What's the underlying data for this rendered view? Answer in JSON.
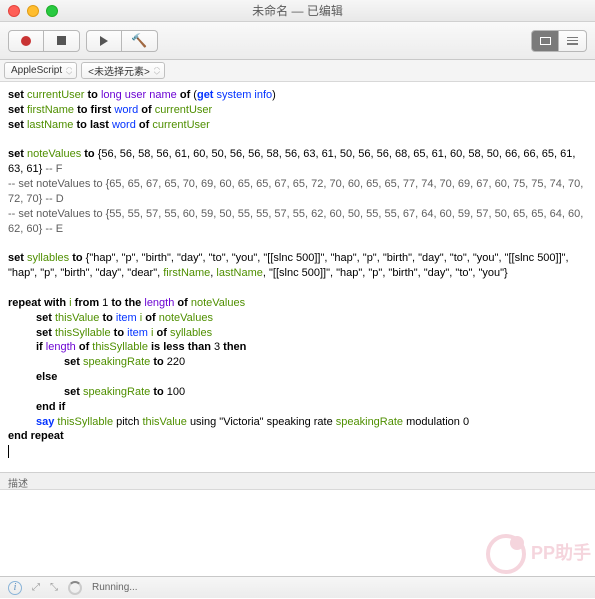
{
  "title": "未命名 — 已编辑",
  "lang_dropdown": "AppleScript",
  "elements_dropdown": "<未选择元素>",
  "desc_label": "描述",
  "status_text": "Running...",
  "code": {
    "l1_set": "set",
    "l1_var": "currentUser",
    "l1_to": "to",
    "l1_prop": "long user name",
    "l1_of": "of",
    "l1_paren_open": "(",
    "l1_cmd": "get",
    "l1_sys": "system info",
    "l1_paren_close": ")",
    "l2_var": "firstName",
    "l2_word": "word",
    "l2_src": "currentUser",
    "l2_first": "first",
    "l3_var": "lastName",
    "l3_last": "last",
    "l5_var": "noteValues",
    "l5_vals": "{56, 56, 58, 56, 61, 60, 50, 56, 56, 58, 56, 63, 61, 50, 56, 56, 68, 65, 61, 60, 58, 50, 66, 66, 65, 61, 63, 61}",
    "l5_cmt": " -- F",
    "l6_cmt": "-- set noteValues to {65, 65, 67, 65, 70, 69, 60, 65, 65, 67, 65, 72, 70, 60, 65, 65, 77, 74, 70, 69, 67, 60, 75, 75, 74, 70, 72, 70} -- D",
    "l8_cmt": "-- set noteValues to {55, 55, 57, 55, 60, 59, 50, 55, 55, 57, 55, 62, 60, 50, 55, 55, 67, 64, 60, 59, 57, 50, 65, 65, 64, 60, 62, 60} -- E",
    "l10_var": "syllables",
    "l10_vals_a": "{\"hap\", \"p\", \"birth\", \"day\", \"to\", \"you\", \"[[slnc 500]]\", \"hap\", \"p\", \"birth\", \"day\", \"to\", \"you\", \"[[slnc 500]]\", \"hap\", \"p\", \"birth\", \"day\", \"dear\", ",
    "l10_fn": "firstName",
    "l10_ln": "lastName",
    "l10_vals_b": ", \"[[slnc 500]]\", \"hap\", \"p\", \"birth\", \"day\", \"to\", \"you\"}",
    "l13_repeat": "repeat with",
    "l13_i": "i",
    "l13_from": "from",
    "l13_one": "1",
    "l13_tothe": "to the",
    "l13_length": "length",
    "l13_of": "of",
    "l13_nv": "noteValues",
    "l14_tv": "thisValue",
    "l14_item": "item",
    "l14_nv": "noteValues",
    "l15_ts": "thisSyllable",
    "l15_sy": "syllables",
    "l16_if": "if",
    "l16_length": "length",
    "l16_of": "of",
    "l16_ts": "thisSyllable",
    "l16_lt": "is less than",
    "l16_three": "3",
    "l16_then": "then",
    "l17_sr": "speakingRate",
    "l17_220": "220",
    "l18_else": "else",
    "l19_100": "100",
    "l20_endif": "end if",
    "l21_say": "say",
    "l21_pitch": "pitch",
    "l21_using": "using",
    "l21_voice": "\"Victoria\"",
    "l21_spr": "speaking rate",
    "l21_mod": "modulation",
    "l21_zero": "0",
    "l22_end": "end repeat"
  }
}
